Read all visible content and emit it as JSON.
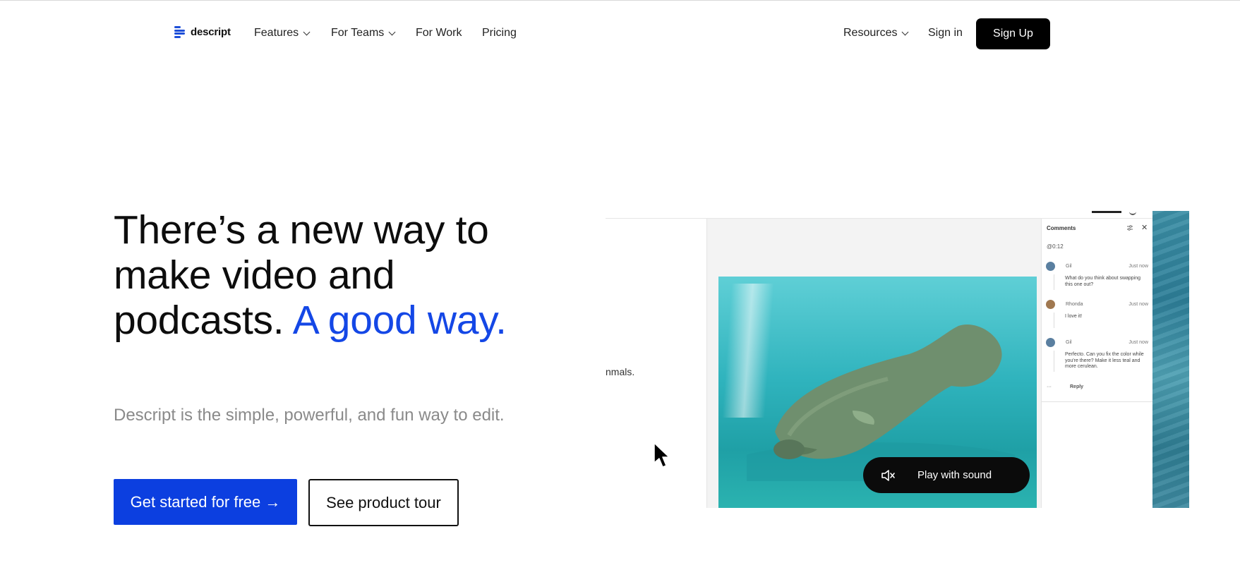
{
  "header": {
    "brand": "descript",
    "nav": [
      {
        "label": "Features",
        "dropdown": true
      },
      {
        "label": "For Teams",
        "dropdown": true
      },
      {
        "label": "For Work",
        "dropdown": false
      },
      {
        "label": "Pricing",
        "dropdown": false
      }
    ],
    "resources_label": "Resources",
    "signin_label": "Sign in",
    "signup_label": "Sign Up"
  },
  "hero": {
    "headline_main": "There’s a new way to make video and podcasts.",
    "headline_accent": "A good way.",
    "subheadline": "Descript is the simple, powerful, and fun way to edit.",
    "primary_cta": "Get started for free →",
    "secondary_cta": "See product tour"
  },
  "mockup": {
    "doc_fragment": "nmals.",
    "play_label": "Play with sound",
    "comments": {
      "title": "Comments",
      "timestamp": "@0:12",
      "items": [
        {
          "author": "Gil",
          "time": "Just now",
          "text": "What do you think about swapping this one out?"
        },
        {
          "author": "Rhonda",
          "time": "Just now",
          "text": "I love it!"
        },
        {
          "author": "Gil",
          "time": "Just now",
          "text": "Perfecto. Can you fix the color while you're there? Make it less teal and more cerulean."
        }
      ],
      "more": "···",
      "reply_label": "Reply"
    }
  },
  "colors": {
    "accent": "#1447e6",
    "primary_button": "#0c3fe0",
    "signup_button": "#000000"
  }
}
